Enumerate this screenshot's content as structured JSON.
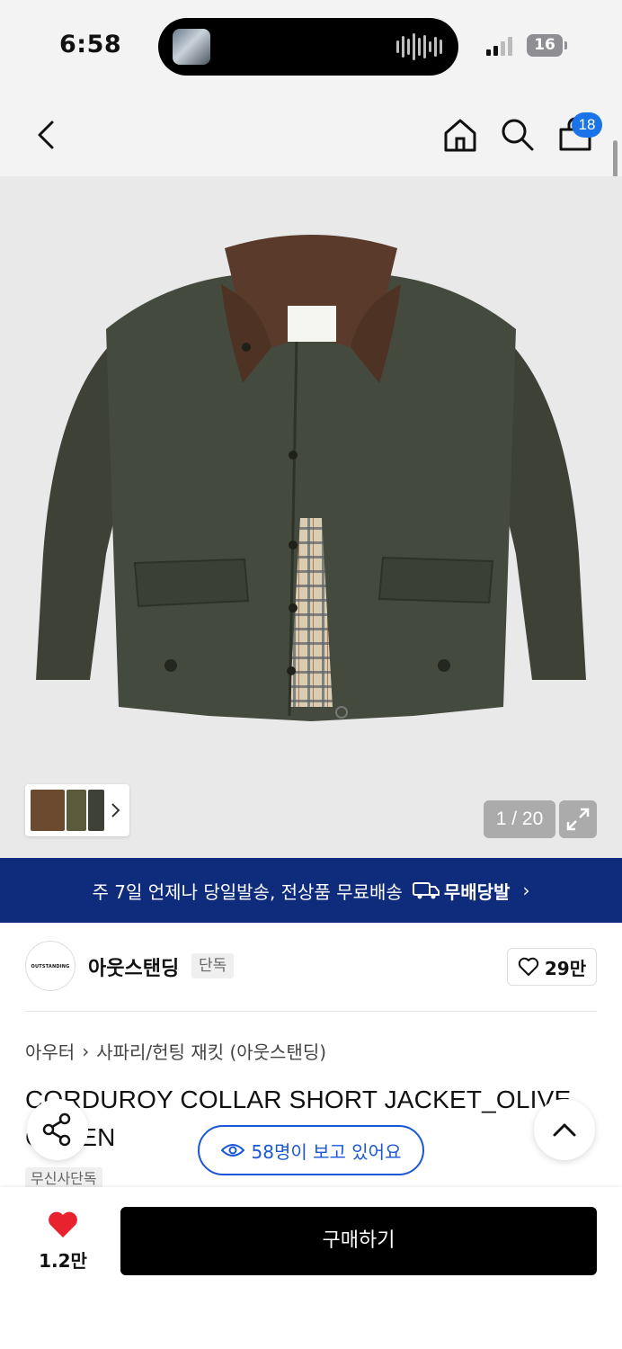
{
  "status_bar": {
    "time": "6:58",
    "battery": "16"
  },
  "nav": {
    "cart_count": "18"
  },
  "gallery": {
    "counter": "1 / 20"
  },
  "promo": {
    "text": "주 7일 언제나 당일발송, 전상품 무료배송",
    "badge": "무배당발"
  },
  "brand": {
    "name": "아웃스탠딩",
    "tag": "단독",
    "likes": "29만",
    "logo_text": "OUTSTANDING"
  },
  "breadcrumb": {
    "category": "아우터",
    "subcategory": "사파리/헌팅 재킷 (아웃스탠딩)"
  },
  "product": {
    "title": "CORDUROY COLLAR SHORT JACKET_OLIVE GREEN",
    "tag": "무신사단독"
  },
  "viewers": {
    "text": "58명이 보고 있어요"
  },
  "bottom": {
    "fav_count": "1.2만",
    "buy_label": "구매하기"
  },
  "colors": {
    "accent": "#1a73e8",
    "promo_bg": "#0f2b7c",
    "heart": "#e8232f",
    "viewer_blue": "#1a57d6"
  }
}
